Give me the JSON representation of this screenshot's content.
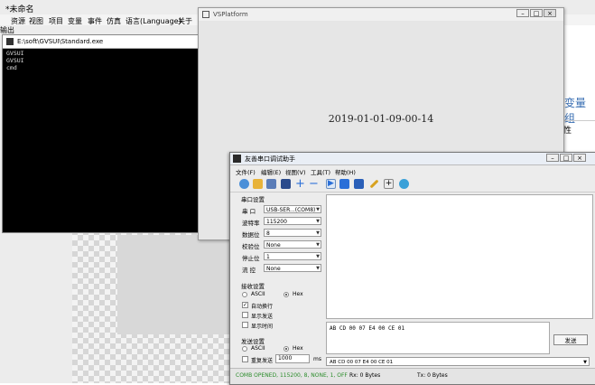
{
  "ide": {
    "title": "*未命名",
    "menu": [
      "资源",
      "视图",
      "项目",
      "变量",
      "事件",
      "仿真",
      "语言(Language)",
      "关于"
    ],
    "output_label": "输出",
    "right_title": "变量组",
    "right_sub": "性"
  },
  "console": {
    "title": "E:\\soft\\GVSUI\\Standard.exe",
    "lines": [
      "GVSUI",
      "GVSUI",
      "cmd"
    ]
  },
  "vsplatform": {
    "title": "VSPlatform",
    "datetime": "2019-01-01-09-00-14"
  },
  "serial": {
    "title": "友善串口调试助手",
    "menu": [
      "文件(F)",
      "编辑(E)",
      "视图(V)",
      "工具(T)",
      "帮助(H)"
    ],
    "port_group": "串口设置",
    "port_label": "串 口",
    "port_value": "USB-SER...(COM8)",
    "baud_label": "波特率",
    "baud_value": "115200",
    "data_label": "数据位",
    "data_value": "8",
    "parity_label": "校验位",
    "parity_value": "None",
    "stop_label": "停止位",
    "stop_value": "1",
    "flow_label": "流 控",
    "flow_value": "None",
    "recv_group": "接收设置",
    "ascii": "ASCII",
    "hex": "Hex",
    "auto_wrap": "自动换行",
    "show_send": "显示发送",
    "show_time": "显示时间",
    "send_group": "发送设置",
    "repeat_send": "重复发送",
    "repeat_interval": "1000",
    "repeat_unit": "ms",
    "send_text": "AB CD 00 07 E4 00 CE 01",
    "send_button": "发送",
    "history_value": "AB CD 00 07 E4 00 CE 01",
    "status_conn": "COMB OPENED, 115200, 8, NONE, 1, OFF",
    "status_rx": "Rx: 0 Bytes",
    "status_tx": "Tx: 0 Bytes"
  },
  "colors": {
    "status_conn": "#2a8c2a",
    "accent": "#3a6fb3"
  }
}
